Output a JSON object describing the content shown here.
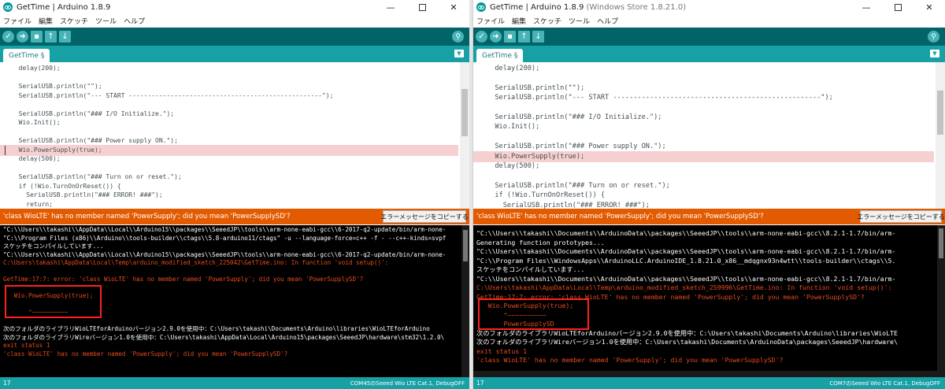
{
  "left": {
    "title": "GetTime | Arduino 1.8.9",
    "title_suffix": "",
    "menu": [
      "ファイル",
      "編集",
      "スケッチ",
      "ツール",
      "ヘルプ"
    ],
    "tab_label": "GetTime §",
    "code": [
      "  delay(200);",
      "",
      "  SerialUSB.println(\"\");",
      "  SerialUSB.println(\"--- START ---------------------------------------------------\");",
      "",
      "  SerialUSB.println(\"### I/O Initialize.\");",
      "  Wio.Init();",
      "",
      "  SerialUSB.println(\"### Power supply ON.\");",
      "  Wio.PowerSupply(true);",
      "  delay(500);",
      "",
      "  SerialUSB.println(\"### Turn on or reset.\");",
      "  if (!Wio.TurnOnOrReset()) {",
      "    SerialUSB.println(\"### ERROR! ###\");",
      "    return;"
    ],
    "error_message": "'class WioLTE' has no member named 'PowerSupply'; did you mean 'PowerSupplySD'?",
    "copy_button": "エラーメッセージをコピーする",
    "console": [
      {
        "t": "\"C:\\\\Users\\\\takashi\\\\AppData\\\\Local\\\\Arduino15\\\\packages\\\\SeeedJP\\\\tools\\\\arm-none-eabi-gcc\\\\6-2017-q2-update/bin/arm-none-",
        "c": "w"
      },
      {
        "t": "\"C:\\\\Program Files (x86)\\\\Arduino\\\\tools-builder\\\\ctags\\\\5.8-arduino11/ctags\" -u --language-force=c++ -f - --c++-kinds=svpf",
        "c": "w"
      },
      {
        "t": "スケッチをコンパイルしています...",
        "c": "w"
      },
      {
        "t": "\"C:\\\\Users\\\\takashi\\\\AppData\\\\Local\\\\Arduino15\\\\packages\\\\SeeedJP\\\\tools\\\\arm-none-eabi-gcc\\\\6-2017-q2-update/bin/arm-none-",
        "c": "w"
      },
      {
        "t": "C:\\Users\\takashi\\AppData\\Local\\Temp\\arduino_modified_sketch_225042\\GetTime.ino: In function 'void setup()':",
        "c": "e"
      },
      {
        "t": "",
        "c": "w"
      },
      {
        "t": "GetTime:17:7: error: 'class WioLTE' has no member named 'PowerSupply'; did you mean 'PowerSupplySD'?",
        "c": "e"
      },
      {
        "t": "",
        "c": "w"
      },
      {
        "t": "   Wio.PowerSupply(true);",
        "c": "e"
      },
      {
        "t": "",
        "c": "w"
      },
      {
        "t": "       ^~~~~~~~~~~",
        "c": "e"
      },
      {
        "t": "",
        "c": "w"
      },
      {
        "t": "次のフォルダのライブラリWioLTEforArduinoバージョン2.9.0を使用中：C:\\Users\\takashi\\Documents\\Arduino\\libraries\\WioLTEforArduino",
        "c": "w"
      },
      {
        "t": "次のフォルダのライブラリWireバージョン1.0を使用中：C:\\Users\\takashi\\AppData\\Local\\Arduino15\\packages\\SeeedJP\\hardware\\stm32\\1.2.0\\",
        "c": "w"
      },
      {
        "t": "exit status 1",
        "c": "e"
      },
      {
        "t": "'class WioLTE' has no member named 'PowerSupply'; did you mean 'PowerSupplySD'?",
        "c": "e"
      }
    ],
    "status_line": "17",
    "status_board": "COM45のSeeed Wio LTE Cat.1, DebugOFF"
  },
  "right": {
    "title": "GetTime | Arduino 1.8.9",
    "title_suffix": " (Windows Store 1.8.21.0)",
    "menu": [
      "ファイル",
      "編集",
      "スケッチ",
      "ツール",
      "ヘルプ"
    ],
    "tab_label": "GetTime §",
    "code": [
      "  delay(200);",
      "",
      "  SerialUSB.println(\"\");",
      "  SerialUSB.println(\"--- START ---------------------------------------------------\");",
      "",
      "  SerialUSB.println(\"### I/O Initialize.\");",
      "  Wio.Init();",
      "",
      "  SerialUSB.println(\"### Power supply ON.\");",
      "  Wio.PowerSupply(true);",
      "  delay(500);",
      "",
      "  SerialUSB.println(\"### Turn on or reset.\");",
      "  if (!Wio.TurnOnOrReset()) {",
      "    SerialUSB.println(\"### ERROR! ###\");"
    ],
    "error_message": "'class WioLTE' has no member named 'PowerSupply'; did you mean 'PowerSupplySD'?",
    "copy_button": "エラーメッセージをコピーする",
    "console": [
      {
        "t": "\"C:\\\\Users\\\\takashi\\\\Documents\\\\ArduinoData\\\\packages\\\\SeeedJP\\\\tools\\\\arm-none-eabi-gcc\\\\8.2.1-1.7/bin/arm-",
        "c": "w"
      },
      {
        "t": "Generating function prototypes...",
        "c": "w"
      },
      {
        "t": "\"C:\\\\Users\\\\takashi\\\\Documents\\\\ArduinoData\\\\packages\\\\SeeedJP\\\\tools\\\\arm-none-eabi-gcc\\\\8.2.1-1.7/bin/arm-",
        "c": "w"
      },
      {
        "t": "\"C:\\\\Program Files\\\\WindowsApps\\\\ArduinoLLC.ArduinoIDE_1.8.21.0_x86__mdqgnx93n4wtt\\\\tools-builder\\\\ctags\\\\5.",
        "c": "w"
      },
      {
        "t": "スケッチをコンパイルしています...",
        "c": "w"
      },
      {
        "t": "\"C:\\\\Users\\\\takashi\\\\Documents\\\\ArduinoData\\\\packages\\\\SeeedJP\\\\tools\\\\arm-none-eabi-gcc\\\\8.2.1-1.7/bin/arm-",
        "c": "w"
      },
      {
        "t": "C:\\Users\\takashi\\AppData\\Local\\Temp\\arduino_modified_sketch_259996\\GetTime.ino: In function 'void setup()':",
        "c": "e"
      },
      {
        "t": "GetTime:17:7: error: 'class WioLTE' has no member named 'PowerSupply'; did you mean 'PowerSupplySD'?",
        "c": "e"
      },
      {
        "t": "   Wio.PowerSupply(true);",
        "c": "e"
      },
      {
        "t": "       ^~~~~~~~~~~",
        "c": "e"
      },
      {
        "t": "       PowerSupplySD",
        "c": "e"
      },
      {
        "t": "次のフォルダのライブラリWioLTEforArduinoバージョン2.9.0を使用中：C:\\Users\\takashi\\Documents\\Arduino\\libraries\\WioLTE",
        "c": "w"
      },
      {
        "t": "次のフォルダのライブラリWireバージョン1.0を使用中：C:\\Users\\takashi\\Documents\\ArduinoData\\packages\\SeeedJP\\hardware\\",
        "c": "w"
      },
      {
        "t": "exit status 1",
        "c": "e"
      },
      {
        "t": "'class WioLTE' has no member named 'PowerSupply'; did you mean 'PowerSupplySD'?",
        "c": "e"
      }
    ],
    "status_line": "17",
    "status_board": "COM7のSeeed Wio LTE Cat.1, DebugOFF"
  },
  "window_controls": {
    "minimize": "—",
    "maximize": "",
    "close": "✕"
  },
  "toolbar_glyphs": {
    "verify": "✓",
    "upload": "➜",
    "new": "▪",
    "open": "↑",
    "save": "↓",
    "serial_monitor": "⚲"
  },
  "tab_menu_glyph": "▼",
  "colors": {
    "toolbar": "#006468",
    "tabstrip": "#17a1a5",
    "error_bar": "#e35b00",
    "console_bg": "#000000",
    "console_error": "#e84b1d",
    "highlight_line": "#f6d0d0",
    "annotation_box": "#ff2020"
  }
}
